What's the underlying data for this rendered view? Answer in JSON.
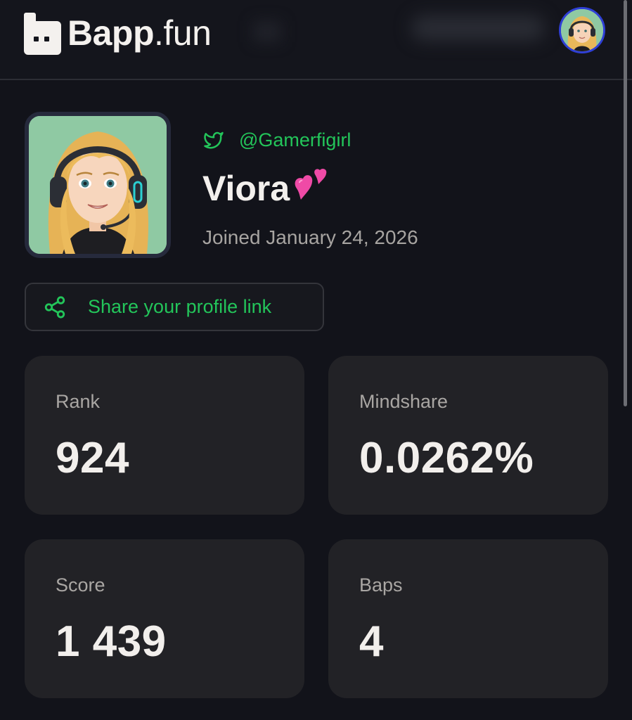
{
  "header": {
    "logo_bold": "Bapp",
    "logo_suffix": ".fun"
  },
  "profile": {
    "twitter_handle": "@Gamerfigirl",
    "display_name": "Viora",
    "joined": "Joined January 24, 2026",
    "share_label": "Share your profile link"
  },
  "stats": [
    {
      "label": "Rank",
      "value": "924"
    },
    {
      "label": "Mindshare",
      "value": "0.0262%"
    },
    {
      "label": "Score",
      "value": "1 439"
    },
    {
      "label": "Baps",
      "value": "4"
    }
  ],
  "icons": {
    "logo": "bapp-logo-icon",
    "twitter": "twitter-icon",
    "share": "share-icon",
    "emoji": "two-hearts-emoji"
  },
  "colors": {
    "background": "#12131a",
    "accent_green": "#23c55a",
    "card": "#222226",
    "avatar_ring": "#2f3fd6"
  }
}
